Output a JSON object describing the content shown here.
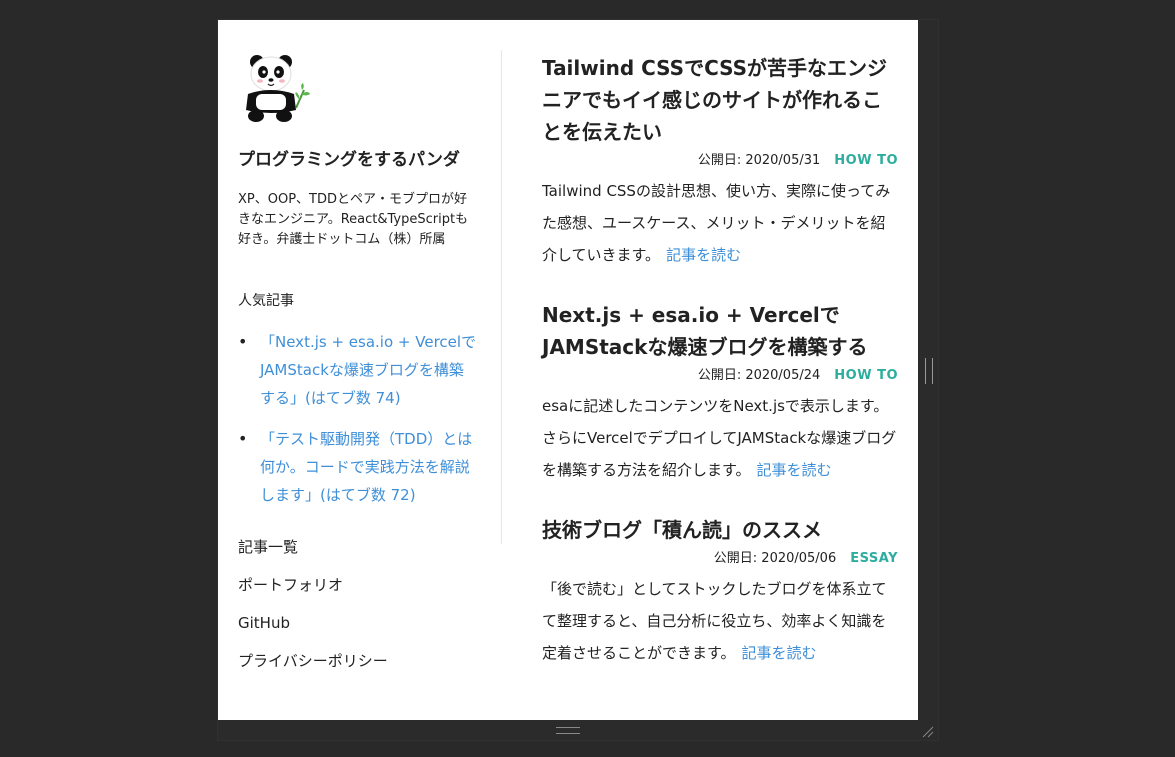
{
  "sidebar": {
    "site_title": "プログラミングをするパンダ",
    "site_description": "XP、OOP、TDDとペア・モブプロが好きなエンジニア。React&TypeScriptも好き。弁護士ドットコム（株）所属",
    "popular_heading": "人気記事",
    "popular_posts": [
      {
        "label": "「Next.js + esa.io + VercelでJAMStackな爆速ブログを構築する」(はてブ数 74)"
      },
      {
        "label": "「テスト駆動開発（TDD）とは何か。コードで実践方法を解説します」(はてブ数 72)"
      }
    ],
    "bullet": "•",
    "nav": [
      {
        "label": "記事一覧"
      },
      {
        "label": "ポートフォリオ"
      },
      {
        "label": "GitHub"
      },
      {
        "label": "プライバシーポリシー"
      }
    ]
  },
  "posts": [
    {
      "title": "Tailwind CSSでCSSが苦手なエンジニアでもイイ感じのサイトが作れることを伝えたい",
      "date": "公開日: 2020/05/31",
      "category": "HOW TO",
      "excerpt": "Tailwind CSSの設計思想、使い方、実際に使ってみた感想、ユースケース、メリット・デメリットを紹介していきます。",
      "read_more": "記事を読む"
    },
    {
      "title": "Next.js + esa.io + VercelでJAMStackな爆速ブログを構築する",
      "date": "公開日: 2020/05/24",
      "category": "HOW TO",
      "excerpt": "esaに記述したコンテンツをNext.jsで表示します。さらにVercelでデプロイしてJAMStackな爆速ブログを構築する方法を紹介します。",
      "read_more": "記事を読む"
    },
    {
      "title": "技術ブログ「積ん読」のススメ",
      "date": "公開日: 2020/05/06",
      "category": "ESSAY",
      "excerpt": "「後で読む」としてストックしたブログを体系立てて整理すると、自己分析に役立ち、効率よく知識を定着させることができます。",
      "read_more": "記事を読む"
    }
  ],
  "colors": {
    "link": "#3f8fd8",
    "category": "#2cad9e",
    "backdrop": "#292929"
  }
}
